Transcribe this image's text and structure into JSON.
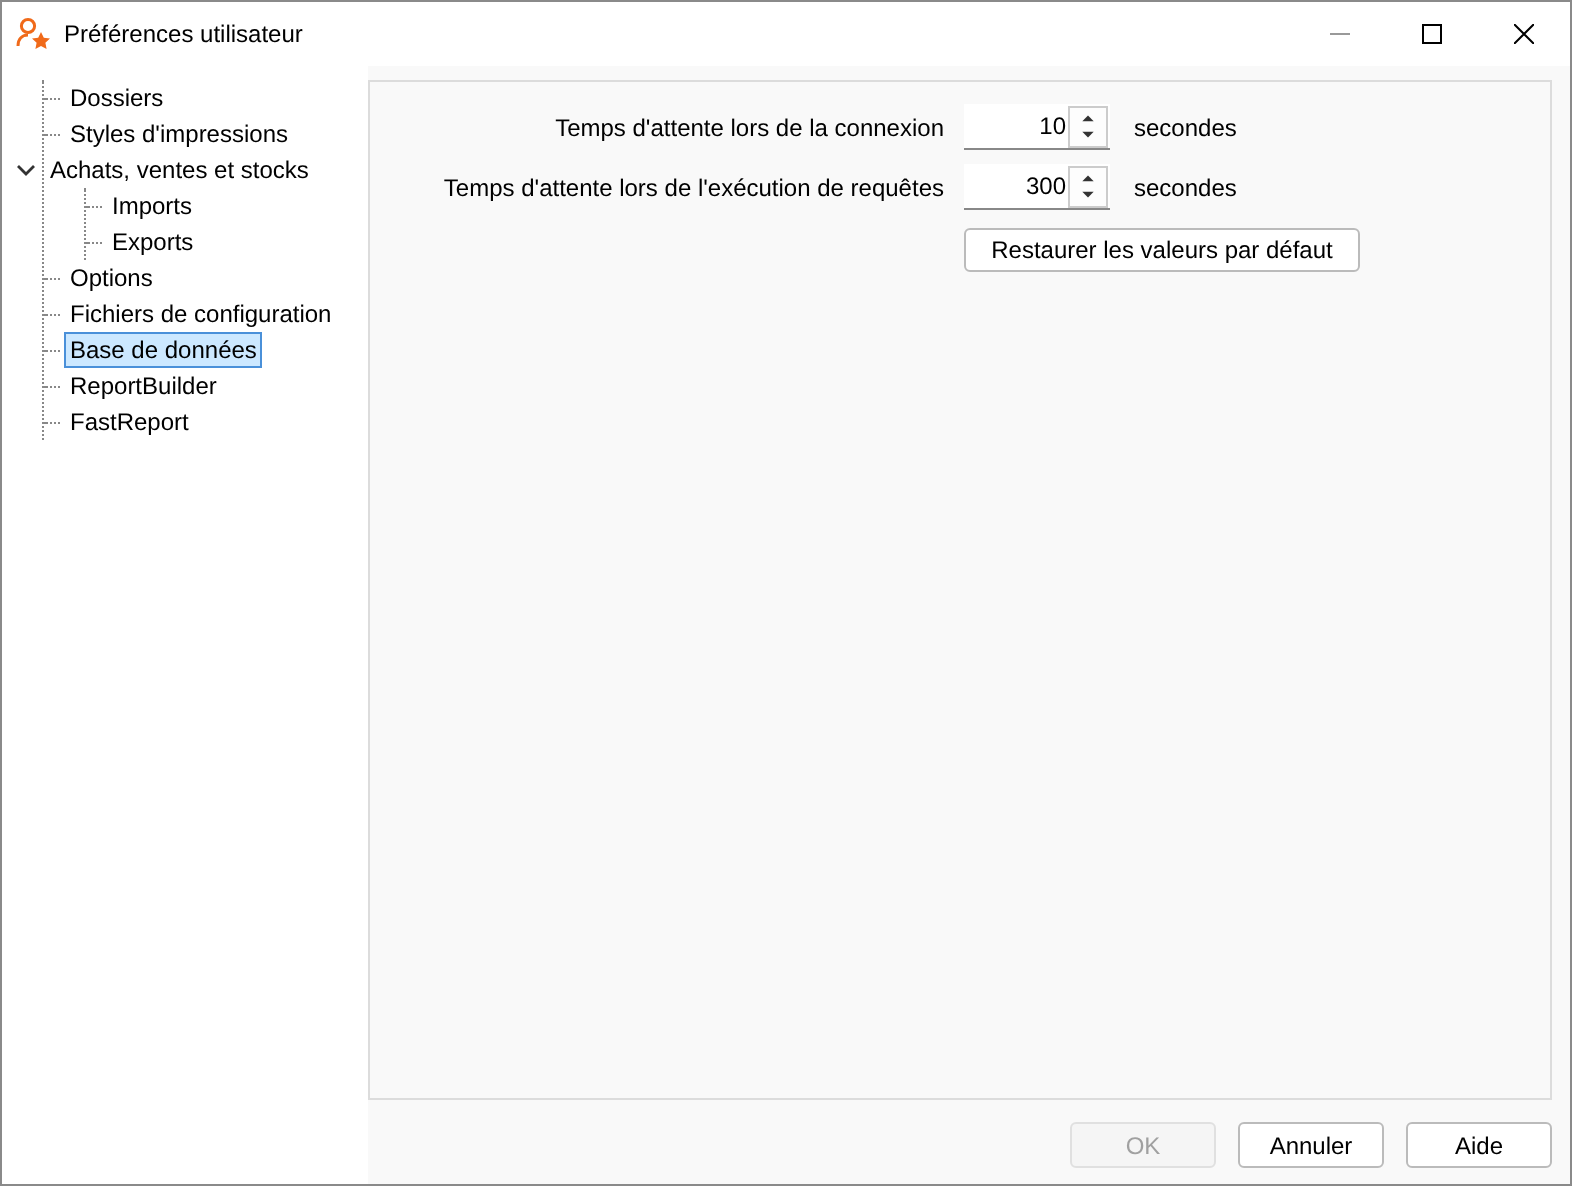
{
  "window": {
    "title": "Préférences utilisateur"
  },
  "tree": [
    {
      "label": "Dossiers",
      "selected": false
    },
    {
      "label": "Styles d'impressions",
      "selected": false
    },
    {
      "label": "Achats, ventes et stocks",
      "selected": false,
      "expanded": true,
      "children": [
        {
          "label": "Imports",
          "selected": false
        },
        {
          "label": "Exports",
          "selected": false
        }
      ]
    },
    {
      "label": "Options",
      "selected": false
    },
    {
      "label": "Fichiers de configuration",
      "selected": false
    },
    {
      "label": "Base de données",
      "selected": true
    },
    {
      "label": "ReportBuilder",
      "selected": false
    },
    {
      "label": "FastReport",
      "selected": false
    }
  ],
  "settings": [
    {
      "label": "Temps d'attente lors de la connexion",
      "value": "10",
      "unit": "secondes"
    },
    {
      "label": "Temps d'attente lors de l'exécution de requêtes",
      "value": "300",
      "unit": "secondes"
    }
  ],
  "restore_button": "Restaurer les valeurs par défaut",
  "buttons": [
    {
      "label": "OK",
      "disabled": true
    },
    {
      "label": "Annuler",
      "disabled": false
    },
    {
      "label": "Aide",
      "disabled": false
    }
  ]
}
